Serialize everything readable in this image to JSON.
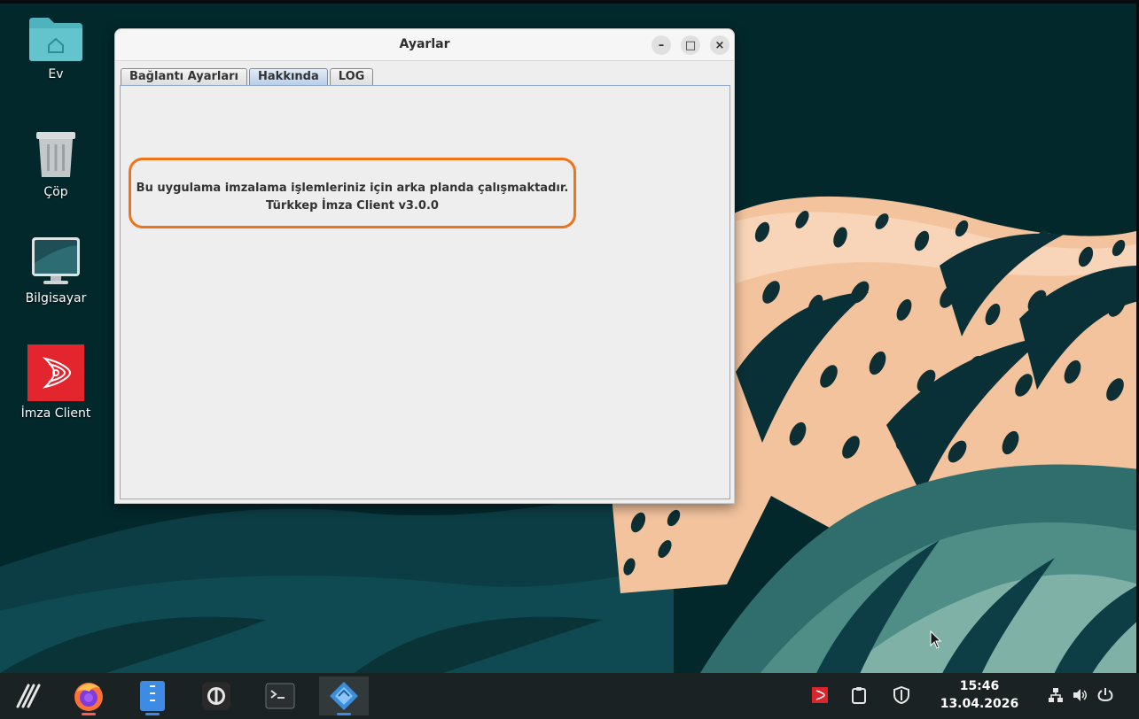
{
  "desktop": {
    "icons": [
      {
        "label": "Ev"
      },
      {
        "label": "Çöp"
      },
      {
        "label": "Bilgisayar"
      },
      {
        "label": "İmza Client"
      }
    ]
  },
  "window": {
    "title": "Ayarlar",
    "controls": {
      "minimize": "–",
      "maximize": "□",
      "close": "×"
    },
    "tabs": [
      {
        "label": "Bağlantı Ayarları",
        "active": false
      },
      {
        "label": "Hakkında",
        "active": true
      },
      {
        "label": "LOG",
        "active": false
      }
    ],
    "about": {
      "line1": "Bu uygulama imzalama işlemleriniz için arka planda çalışmaktadır.",
      "line2": "Türkkep İmza Client v3.0.0"
    }
  },
  "taskbar": {
    "apps": [
      "app-menu-icon",
      "firefox-icon",
      "file-manager-icon",
      "password-manager-icon",
      "terminal-icon",
      "java-app-icon"
    ],
    "tray": [
      "imza-tray-icon",
      "clipboard-icon",
      "shield-icon",
      "network-icon",
      "volume-icon",
      "power-icon"
    ],
    "clock": {
      "time": "15:46",
      "date": "13.04.2026"
    }
  },
  "colors": {
    "highlight": "#f07318",
    "accent": "#3d8be2",
    "taskbar_bg": "#1b2224"
  }
}
